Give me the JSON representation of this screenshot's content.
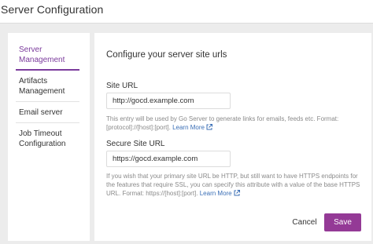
{
  "header": {
    "title": "Server Configuration"
  },
  "sidebar": {
    "items": [
      {
        "label": "Server Management",
        "active": true
      },
      {
        "label": "Artifacts Management",
        "active": false
      },
      {
        "label": "Email server",
        "active": false
      },
      {
        "label": "Job Timeout Configuration",
        "active": false
      }
    ]
  },
  "main": {
    "heading": "Configure your server site urls",
    "site_url": {
      "label": "Site URL",
      "value": "http://gocd.example.com",
      "help": "This entry will be used by Go Server to generate links for emails, feeds etc. Format: [protocol]://[host]:[port].",
      "link": "Learn More"
    },
    "secure_site_url": {
      "label": "Secure Site URL",
      "value": "https://gocd.example.com",
      "help": "If you wish that your primary site URL be HTTP, but still want to have HTTPS endpoints for the features that require SSL, you can specify this attribute with a value of the base HTTPS URL. Format: https://[host]:[port].",
      "link": "Learn More"
    },
    "buttons": {
      "cancel": "Cancel",
      "save": "Save"
    }
  },
  "colors": {
    "accent": "#7b3b9c",
    "save_button": "#943a96",
    "link": "#3b6fb6"
  },
  "icons": {
    "external_link": "external-link-icon"
  }
}
